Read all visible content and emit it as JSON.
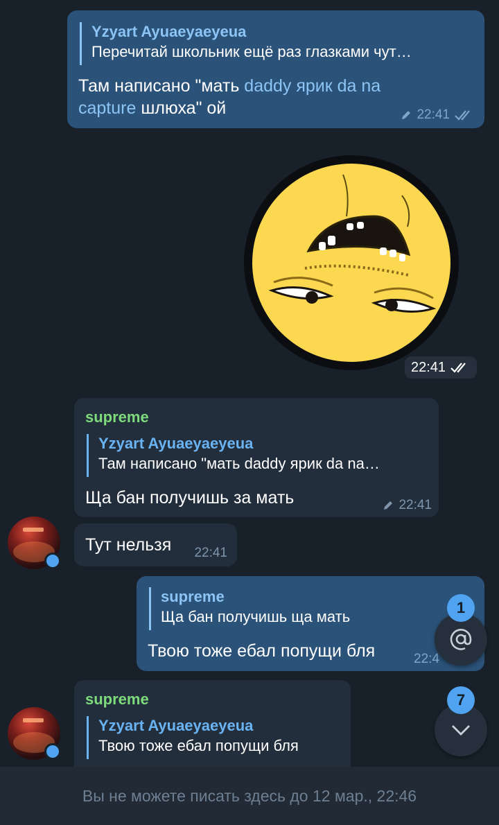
{
  "messages": {
    "m1": {
      "reply_name": "Yzyart Ayuaeyaeyeua",
      "reply_text": "Перечитай школьник ещё раз глазками чут…",
      "text_before": "Там написано \"мать ",
      "text_link": "daddy ярик da na capture",
      "text_after": " шлюха\" ой",
      "time": "22:41"
    },
    "sticker": {
      "time": "22:41"
    },
    "m2": {
      "sender": "supreme",
      "reply_name": "Yzyart Ayuaeyaeyeua",
      "reply_text": "Там написано \"мать daddy ярик da na…",
      "text": "Ща бан получишь за мать",
      "time": "22:41"
    },
    "m3": {
      "text": "Тут нельзя",
      "time": "22:41"
    },
    "m4": {
      "reply_name": "supreme",
      "reply_text": "Ща бан получишь ща мать",
      "text": "Твою тоже ебал попущи бля",
      "time": "22:4"
    },
    "m5": {
      "sender": "supreme",
      "reply_name": "Yzyart Ayuaeyaeyeua",
      "reply_text": "Твою тоже ебал попущи бля"
    }
  },
  "mentions_badge": "1",
  "scroll_badge": "7",
  "bottom_notice": "Вы не можете писать здесь до 12 мар., 22:46",
  "colors": {
    "background": "#182029",
    "outgoing_bubble": "#2b5278",
    "incoming_bubble": "#232e3c",
    "accent": "#4fa3f0",
    "sender_green": "#7ddb7b"
  },
  "icons": [
    "pencil-icon",
    "double-check-icon",
    "at-sign-icon",
    "chevron-down-icon"
  ]
}
